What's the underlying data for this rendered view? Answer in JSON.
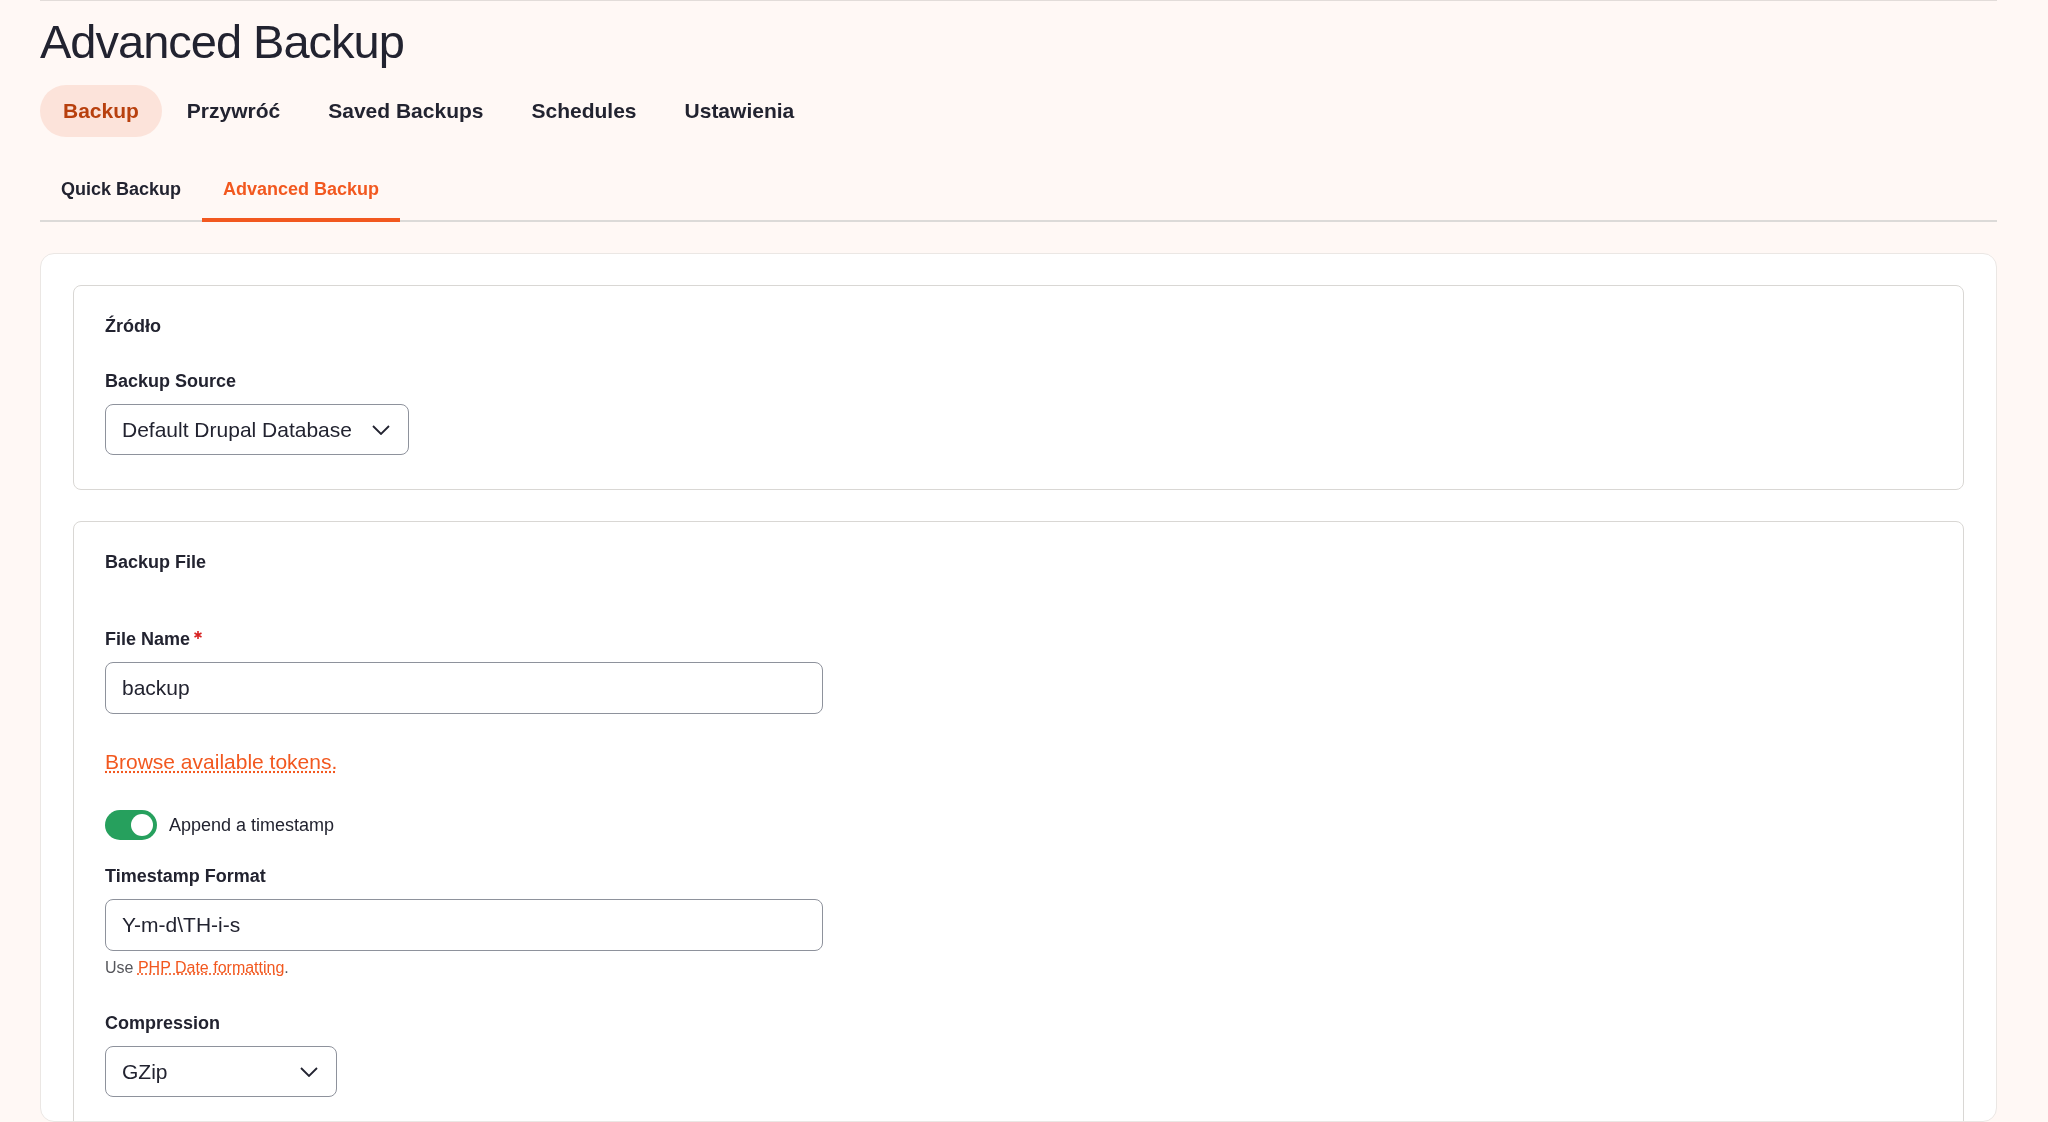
{
  "page": {
    "title": "Advanced Backup"
  },
  "primary_tabs": [
    {
      "label": "Backup",
      "selected": true
    },
    {
      "label": "Przywróć",
      "selected": false
    },
    {
      "label": "Saved Backups",
      "selected": false
    },
    {
      "label": "Schedules",
      "selected": false
    },
    {
      "label": "Ustawienia",
      "selected": false
    }
  ],
  "secondary_tabs": [
    {
      "label": "Quick Backup",
      "selected": false
    },
    {
      "label": "Advanced Backup",
      "selected": true
    }
  ],
  "sections": [
    {
      "legend": "Źródło",
      "fields": [
        {
          "kind": "select",
          "label": "Backup Source",
          "value": "Default Drupal Database",
          "required": false
        }
      ]
    },
    {
      "legend": "Backup File",
      "fields": [
        {
          "kind": "text",
          "label": "File Name",
          "value": "backup",
          "required": true
        },
        {
          "kind": "link",
          "text": "Browse available tokens."
        },
        {
          "kind": "toggle",
          "label": "Append a timestamp",
          "on": true
        },
        {
          "kind": "text",
          "label": "Timestamp Format",
          "value": "Y-m-d\\TH-i-s",
          "required": false,
          "help": {
            "before": "Use ",
            "link": "PHP Date formatting",
            "after": "."
          }
        },
        {
          "kind": "select",
          "label": "Compression",
          "value": "GZip",
          "required": false
        }
      ]
    }
  ]
}
